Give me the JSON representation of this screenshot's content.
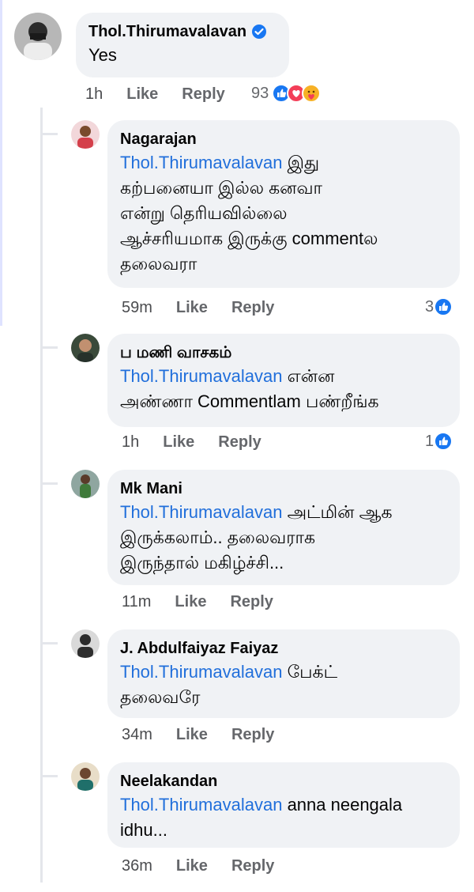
{
  "comment": {
    "author": "Thol.Thirumavalavan",
    "text": "Yes",
    "time": "1h",
    "like": "Like",
    "reply": "Reply",
    "reaction_count": "93"
  },
  "replies": [
    {
      "author": "Nagarajan",
      "mention": "Thol.Thirumavalavan",
      "text_lines": [
        "இது",
        "கற்பனையா இல்ல கனவா",
        "என்று தெரியவில்லை",
        "ஆச்சரியமாக இருக்கு commentல",
        "தலைவரா"
      ],
      "time": "59m",
      "like": "Like",
      "reply": "Reply",
      "reaction_count": "3"
    },
    {
      "author": "ப மணி வாசகம்",
      "mention": "Thol.Thirumavalavan",
      "text_lines": [
        "என்ன",
        "அண்ணா Commentlam பண்றீங்க"
      ],
      "time": "1h",
      "like": "Like",
      "reply": "Reply",
      "reaction_count": "1"
    },
    {
      "author": "Mk Mani",
      "mention": "Thol.Thirumavalavan",
      "text_lines": [
        "அட்மின் ஆக",
        "இருக்கலாம்.. தலைவராக",
        "இருந்தால் மகிழ்ச்சி..."
      ],
      "time": "11m",
      "like": "Like",
      "reply": "Reply",
      "reaction_count": ""
    },
    {
      "author": "J. Abdulfaiyaz Faiyaz",
      "mention": "Thol.Thirumavalavan",
      "text_lines": [
        "பேக்ட்",
        "தலைவரே"
      ],
      "time": "34m",
      "like": "Like",
      "reply": "Reply",
      "reaction_count": ""
    },
    {
      "author": "Neelakandan",
      "mention": "Thol.Thirumavalavan",
      "text_lines": [
        "anna neengala",
        "idhu..."
      ],
      "time": "36m",
      "like": "Like",
      "reply": "Reply",
      "reaction_count": ""
    }
  ],
  "colors": {
    "mention": "#216fdb",
    "bubble": "#f0f2f5",
    "like_blue": "#1877f2",
    "love_red": "#f33e58",
    "care_yellow": "#f7b125"
  },
  "icons": [
    "verified-badge-icon",
    "like-reaction-icon",
    "love-reaction-icon",
    "care-reaction-icon"
  ]
}
